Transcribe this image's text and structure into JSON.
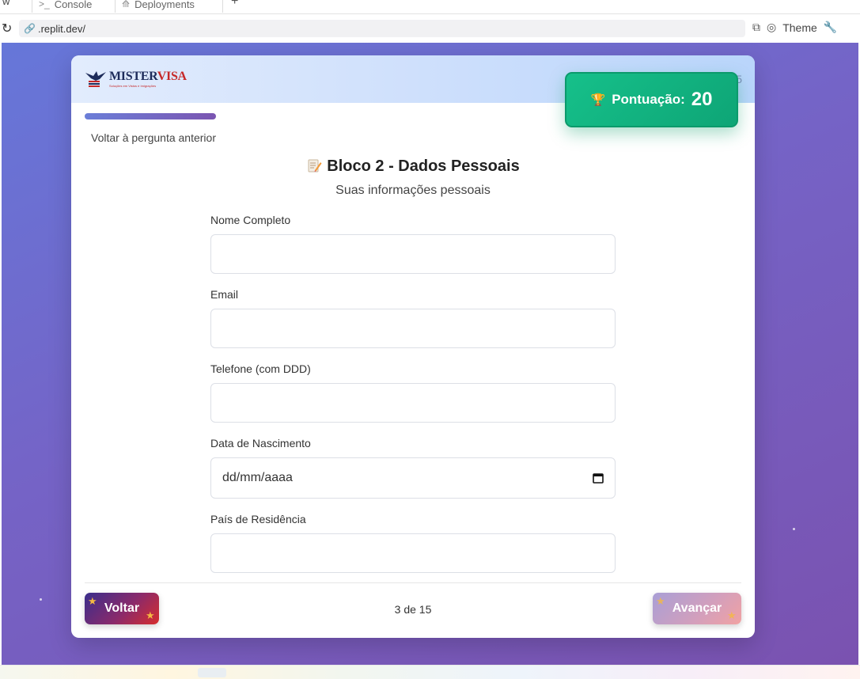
{
  "browser": {
    "cut_tab_text": "w",
    "tabs": [
      {
        "icon": "terminal-icon",
        "label": "Console"
      },
      {
        "icon": "deploy-icon",
        "label": "Deployments"
      }
    ],
    "new_tab": "+",
    "url": ".replit.dev/",
    "theme_label": "Theme"
  },
  "header": {
    "brand_name_part1": "MISTER",
    "brand_name_part2": "VISA",
    "brand_tagline": "Soluções em Vistos e Imigrações",
    "counter_partial": "5"
  },
  "score": {
    "label": "Pontuação:",
    "value": "20"
  },
  "nav": {
    "back_link": "Voltar à pergunta anterior"
  },
  "block": {
    "title": "Bloco 2 - Dados Pessoais",
    "subtitle": "Suas informações pessoais"
  },
  "form": {
    "fields": [
      {
        "label": "Nome Completo",
        "value": ""
      },
      {
        "label": "Email",
        "value": ""
      },
      {
        "label": "Telefone (com DDD)",
        "value": ""
      },
      {
        "label": "Data de Nascimento",
        "value": "dd/mm/aaaa"
      },
      {
        "label": "País de Residência",
        "value": ""
      }
    ]
  },
  "footer": {
    "back_button": "Voltar",
    "next_button": "Avançar",
    "step": "3 de 15"
  },
  "colors": {
    "accent_green": "#16c08a",
    "brand_navy": "#1d2b5a",
    "brand_red": "#c62828",
    "bg_gradient_start": "#6677d9",
    "bg_gradient_end": "#7a52b0"
  }
}
